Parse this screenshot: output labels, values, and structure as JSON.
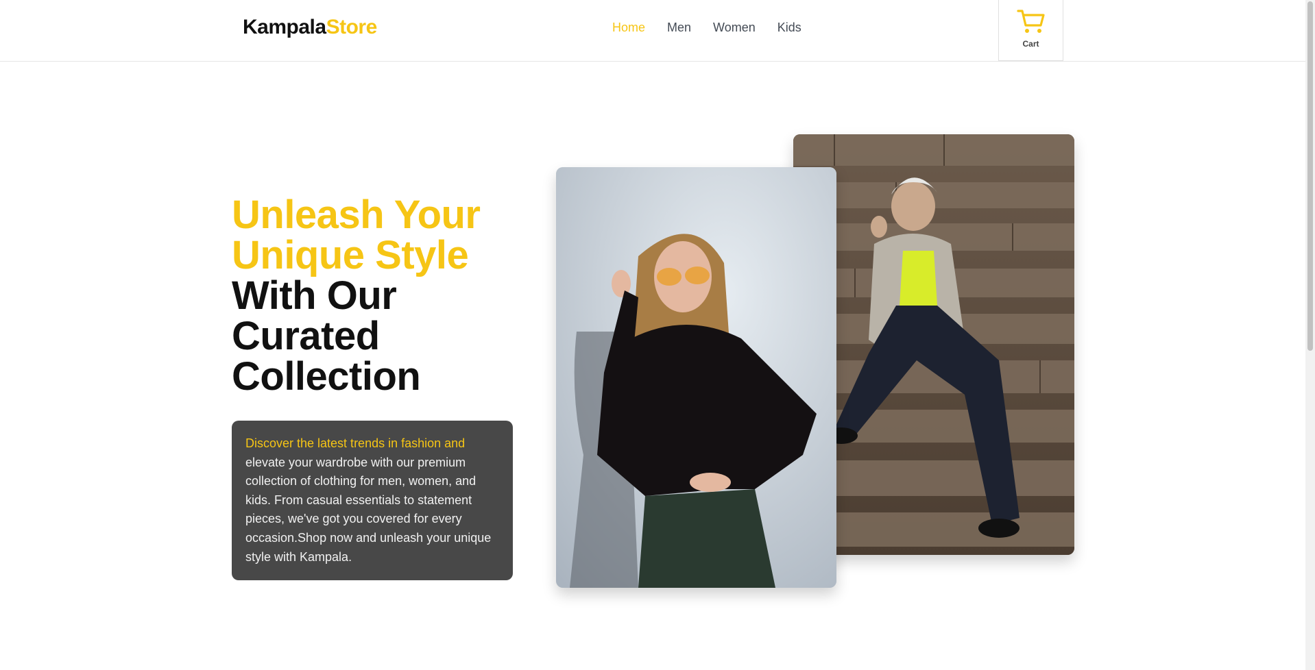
{
  "header": {
    "logo_part1": "Kampala",
    "logo_part2": "Store",
    "nav": [
      {
        "label": "Home",
        "active": true
      },
      {
        "label": "Men",
        "active": false
      },
      {
        "label": "Women",
        "active": false
      },
      {
        "label": "Kids",
        "active": false
      }
    ],
    "cart_label": "Cart",
    "cart_icon": "cart-icon"
  },
  "hero": {
    "headline_yellow_line1": "Unleash Your",
    "headline_yellow_line2": "Unique Style",
    "headline_black_line1": "With Our",
    "headline_black_line2": "Curated",
    "headline_black_line3": "Collection",
    "description_highlight": "Discover the latest trends in fashion and",
    "description_rest": " elevate your wardrobe with our premium collection of clothing for men, women, and kids. From casual essentials to statement pieces, we've got you covered for every occasion.Shop now and unleash your unique style with Kampala."
  },
  "colors": {
    "accent": "#f6c515",
    "text_dark": "#111111",
    "nav_text": "#444b55",
    "description_box": "#484848"
  }
}
